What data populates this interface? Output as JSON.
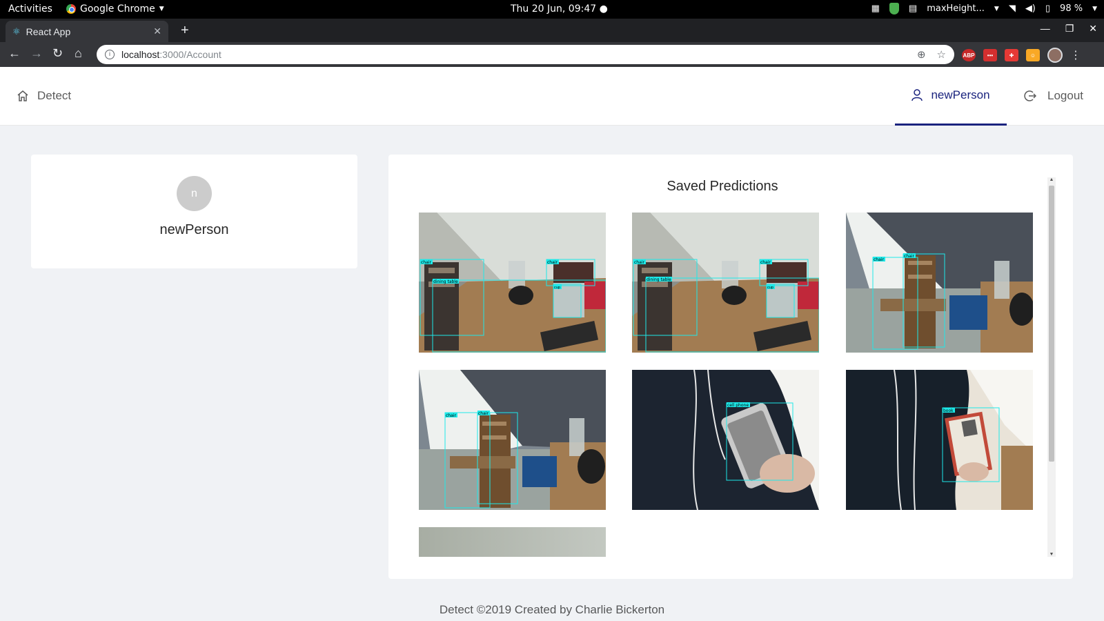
{
  "system_bar": {
    "activities": "Activities",
    "app_name": "Google Chrome",
    "clock": "Thu 20 Jun, 09:47 ●",
    "window_label": "maxHeight...",
    "battery": "98 %"
  },
  "browser": {
    "tab_title": "React App",
    "url_host": "localhost",
    "url_path": ":3000/Account",
    "extension_abp": "ABP"
  },
  "header": {
    "home_label": "Detect",
    "user_label": "newPerson",
    "logout_label": "Logout"
  },
  "profile": {
    "avatar_letter": "n",
    "name": "newPerson"
  },
  "predictions": {
    "title": "Saved Predictions",
    "items": [
      {
        "scene": "desk",
        "labels": [
          "chair",
          "dining table",
          "chair",
          "cup"
        ]
      },
      {
        "scene": "desk",
        "labels": [
          "chair",
          "dining table",
          "chair",
          "cup"
        ]
      },
      {
        "scene": "chair",
        "labels": [
          "chair",
          "chair"
        ]
      },
      {
        "scene": "chair",
        "labels": [
          "chair",
          "chair"
        ]
      },
      {
        "scene": "phone",
        "labels": [
          "cell phone"
        ]
      },
      {
        "scene": "book",
        "labels": [
          "book"
        ]
      },
      {
        "scene": "wall",
        "labels": []
      }
    ]
  },
  "footer": {
    "text": "Detect ©2019 Created by Charlie Bickerton"
  }
}
